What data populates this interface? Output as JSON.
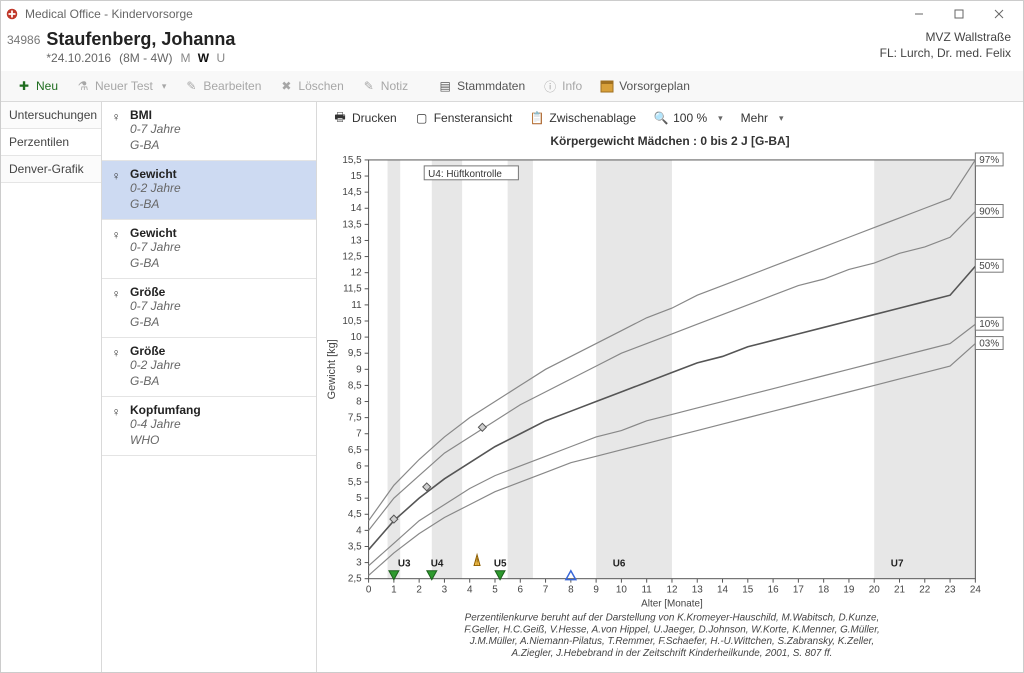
{
  "window": {
    "title": "Medical Office - Kindervorsorge"
  },
  "patient": {
    "id": "34986",
    "name": "Staufenberg, Johanna",
    "dob": "*24.10.2016",
    "age": "(8M - 4W)",
    "mwu": {
      "m": "M",
      "w": "W",
      "u": "U",
      "selected": "W"
    }
  },
  "clinic": {
    "name": "MVZ Wallstraße",
    "doctor": "FL: Lurch, Dr. med. Felix"
  },
  "toolbar": {
    "neu": "Neu",
    "neuer_test": "Neuer Test",
    "bearbeiten": "Bearbeiten",
    "loeschen": "Löschen",
    "notiz": "Notiz",
    "stammdaten": "Stammdaten",
    "info": "Info",
    "vorsorgeplan": "Vorsorgeplan"
  },
  "left_tabs": {
    "items": [
      "Untersuchungen",
      "Perzentilen",
      "Denver-Grafik"
    ],
    "active": 1
  },
  "measure_list": [
    {
      "title": "BMI",
      "range": "0-7 Jahre",
      "source": "G-BA"
    },
    {
      "title": "Gewicht",
      "range": "0-2 Jahre",
      "source": "G-BA"
    },
    {
      "title": "Gewicht",
      "range": "0-7 Jahre",
      "source": "G-BA"
    },
    {
      "title": "Größe",
      "range": "0-7 Jahre",
      "source": "G-BA"
    },
    {
      "title": "Größe",
      "range": "0-2 Jahre",
      "source": "G-BA"
    },
    {
      "title": "Kopfumfang",
      "range": "0-4 Jahre",
      "source": "WHO"
    }
  ],
  "measure_selected": 1,
  "chart_toolbar": {
    "drucken": "Drucken",
    "fenster": "Fensteransicht",
    "zwischen": "Zwischenablage",
    "zoom": "100 %",
    "mehr": "Mehr"
  },
  "chart_title": "Körpergewicht  Mädchen :   0 bis 2 J    [G-BA]",
  "note_box": "U4: Hüftkontrolle",
  "axes": {
    "x_label": "Alter [Monate]",
    "y_label": "Gewicht [kg]",
    "x_ticks": [
      0,
      1,
      2,
      3,
      4,
      5,
      6,
      7,
      8,
      9,
      10,
      11,
      12,
      13,
      14,
      15,
      16,
      17,
      18,
      19,
      20,
      21,
      22,
      23,
      24
    ],
    "y_ticks": [
      2.5,
      3,
      3.5,
      4,
      4.5,
      5,
      5.5,
      6,
      6.5,
      7,
      7.5,
      8,
      8.5,
      9,
      9.5,
      10,
      10.5,
      11,
      11.5,
      12,
      12.5,
      13,
      13.5,
      14,
      14.5,
      15,
      15.5
    ]
  },
  "chart_data": {
    "type": "line",
    "title": "Körpergewicht Mädchen 0–2 J [G-BA]",
    "xlabel": "Alter [Monate]",
    "ylabel": "Gewicht [kg]",
    "xlim": [
      0,
      24
    ],
    "ylim": [
      2.5,
      15.5
    ],
    "x": [
      0,
      1,
      2,
      3,
      4,
      5,
      6,
      7,
      8,
      9,
      10,
      11,
      12,
      13,
      14,
      15,
      16,
      17,
      18,
      19,
      20,
      21,
      22,
      23,
      24
    ],
    "series": [
      {
        "name": "97%",
        "values": [
          4.3,
          5.4,
          6.2,
          6.9,
          7.5,
          8.0,
          8.5,
          9.0,
          9.4,
          9.8,
          10.2,
          10.6,
          10.9,
          11.3,
          11.6,
          11.9,
          12.2,
          12.5,
          12.8,
          13.1,
          13.4,
          13.7,
          14.0,
          14.3,
          15.5
        ]
      },
      {
        "name": "90%",
        "values": [
          4.0,
          5.0,
          5.7,
          6.4,
          6.9,
          7.4,
          7.9,
          8.3,
          8.7,
          9.1,
          9.5,
          9.8,
          10.1,
          10.4,
          10.7,
          11.0,
          11.3,
          11.6,
          11.8,
          12.1,
          12.3,
          12.6,
          12.8,
          13.1,
          13.9
        ]
      },
      {
        "name": "50%",
        "values": [
          3.4,
          4.3,
          5.0,
          5.6,
          6.1,
          6.6,
          7.0,
          7.4,
          7.7,
          8.0,
          8.3,
          8.6,
          8.9,
          9.2,
          9.4,
          9.7,
          9.9,
          10.1,
          10.3,
          10.5,
          10.7,
          10.9,
          11.1,
          11.3,
          12.2
        ]
      },
      {
        "name": "10%",
        "values": [
          2.9,
          3.6,
          4.3,
          4.8,
          5.3,
          5.7,
          6.0,
          6.3,
          6.6,
          6.9,
          7.1,
          7.4,
          7.6,
          7.8,
          8.0,
          8.2,
          8.4,
          8.6,
          8.8,
          9.0,
          9.2,
          9.4,
          9.6,
          9.8,
          10.4
        ]
      },
      {
        "name": "03%",
        "values": [
          2.6,
          3.3,
          3.9,
          4.4,
          4.8,
          5.2,
          5.5,
          5.8,
          6.1,
          6.3,
          6.5,
          6.7,
          6.9,
          7.1,
          7.3,
          7.5,
          7.7,
          7.9,
          8.1,
          8.3,
          8.5,
          8.7,
          8.9,
          9.1,
          9.8
        ]
      }
    ],
    "percentile_labels": [
      "97%",
      "90%",
      "50%",
      "10%",
      "03%"
    ],
    "patient_points": [
      {
        "x": 1.0,
        "y": 4.35
      },
      {
        "x": 2.3,
        "y": 5.35
      },
      {
        "x": 4.5,
        "y": 7.2
      }
    ],
    "u_markers": [
      {
        "name": "U3",
        "x": 1.0
      },
      {
        "name": "U4",
        "x": 2.3
      },
      {
        "name": "U5",
        "x": 4.8,
        "warn": true
      },
      {
        "name": "U6",
        "x": 9.5
      },
      {
        "name": "U7",
        "x": 20.5
      }
    ],
    "u_arrow_x": [
      1.0,
      2.5,
      5.2
    ],
    "current_age_x": 8.0,
    "shaded_x_spans": [
      [
        0.75,
        1.25
      ],
      [
        2.5,
        3.7
      ],
      [
        5.5,
        6.5
      ],
      [
        9.0,
        12.0
      ],
      [
        20.0,
        24.0
      ]
    ]
  },
  "credits": [
    "Perzentilenkurve beruht auf der Darstellung von K.Kromeyer-Hauschild, M.Wabitsch, D.Kunze,",
    "F.Geller, H.C.Geiß, V.Hesse, A.von Hippel, U.Jaeger, D.Johnson, W.Korte, K.Menner, G.Müller,",
    "J.M.Müller, A.Niemann-Pilatus, T.Remmer, F.Schaefer, H.-U.Wittchen, S.Zabransky, K.Zeller,",
    "A.Ziegler, J.Hebebrand in der Zeitschrift Kinderheilkunde, 2001, S. 807 ff."
  ]
}
